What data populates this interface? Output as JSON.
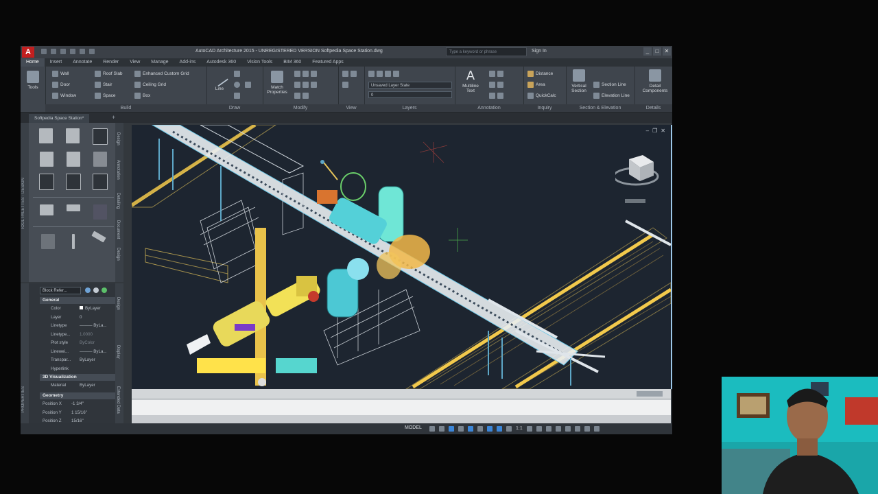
{
  "app": {
    "logo_letter": "A",
    "title": "AutoCAD Architecture 2015 - UNREGISTERED VERSION    Softpedia Space Station.dwg",
    "search_placeholder": "Type a keyword or phrase",
    "sign_in": "Sign In",
    "win_buttons": [
      "_",
      "□",
      "✕"
    ]
  },
  "tabs": [
    "Home",
    "Insert",
    "Annotate",
    "Render",
    "View",
    "Manage",
    "Add-ins",
    "Autodesk 360",
    "Vision Tools",
    "BIM 360",
    "Featured Apps"
  ],
  "ribbon": {
    "tools_label": "Tools",
    "build": {
      "title": "Build",
      "items": [
        "Wall",
        "Door",
        "Window",
        "Roof Slab",
        "Stair",
        "Space",
        "Enhanced Custom Grid",
        "Ceiling Grid",
        "Box"
      ]
    },
    "draw": {
      "title": "Draw",
      "line_label": "Line"
    },
    "modify": {
      "title": "Modify",
      "match_label": "Match Properties"
    },
    "view": {
      "title": "View"
    },
    "layers": {
      "title": "Layers",
      "layer_state": "Unsaved Layer State",
      "current_layer": "0"
    },
    "annotation": {
      "title": "Annotation",
      "text_label": "Multiline Text"
    },
    "inquiry": {
      "title": "Inquiry",
      "items": [
        "Distance",
        "Area",
        "QuickCalc"
      ]
    },
    "section": {
      "title": "Section & Elevation",
      "vertical_label": "Vertical Section",
      "items": [
        "Section Line",
        "Elevation Line"
      ]
    },
    "details": {
      "title": "Details",
      "label": "Detail Components"
    }
  },
  "file_tab": "Softpedia Space Station*",
  "tool_palette": {
    "side_label": "TOOL PALETTES - DESIGN",
    "vtabs": [
      "Design",
      "Annotation",
      "Detailing",
      "Document",
      "Design"
    ]
  },
  "properties": {
    "side_label": "PROPERTIES",
    "selector": "Block Refer...",
    "vtabs": [
      "Design",
      "Display",
      "Extended Data"
    ],
    "general_title": "General",
    "general": [
      {
        "k": "Color",
        "v": "ByLayer"
      },
      {
        "k": "Layer",
        "v": "0"
      },
      {
        "k": "Linetype",
        "v": "——— ByLa..."
      },
      {
        "k": "Linetype...",
        "v": "1.0000"
      },
      {
        "k": "Plot style",
        "v": "ByColor"
      },
      {
        "k": "Linewei...",
        "v": "——— ByLa..."
      },
      {
        "k": "Transpar...",
        "v": "ByLayer"
      },
      {
        "k": "Hyperlink",
        "v": ""
      }
    ],
    "viz_title": "3D Visualization",
    "viz": [
      {
        "k": "Material",
        "v": "ByLayer"
      }
    ],
    "geo_title": "Geometry",
    "geo": [
      {
        "k": "Position X",
        "v": "-1 3/4\""
      },
      {
        "k": "Position Y",
        "v": "1 15/16\""
      },
      {
        "k": "Position Z",
        "v": "15/16\""
      }
    ]
  },
  "status": {
    "model": "MODEL",
    "scale": "1:1"
  },
  "colors": {
    "accent": "#3c86d8",
    "ui_dark": "#33383d",
    "viewport": "#1d2530"
  }
}
